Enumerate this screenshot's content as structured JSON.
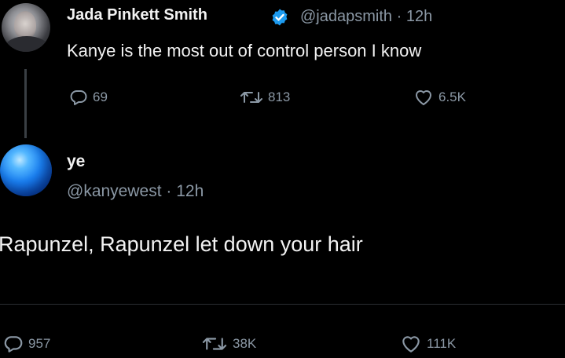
{
  "tweet1": {
    "author_name": "Jada Pinkett Smith",
    "handle": "@jadapsmith",
    "separator": "·",
    "time": "12h",
    "text": "Kanye is the most out of control person I know",
    "replies": "69",
    "retweets": "813",
    "likes": "6.5K",
    "verified": true
  },
  "tweet2": {
    "author_name": "ye",
    "handle": "@kanyewest",
    "separator": "·",
    "time": "12h",
    "text": "Rapunzel, Rapunzel let down your hair",
    "replies": "957",
    "retweets": "38K",
    "likes": "111K"
  },
  "icons": {
    "reply": "reply-icon",
    "retweet": "retweet-icon",
    "like": "heart-icon",
    "verified": "verified-badge-icon"
  },
  "colors": {
    "background": "#000000",
    "text": "#e7e9ea",
    "muted": "#8b98a5",
    "verified": "#1d9bf0"
  }
}
